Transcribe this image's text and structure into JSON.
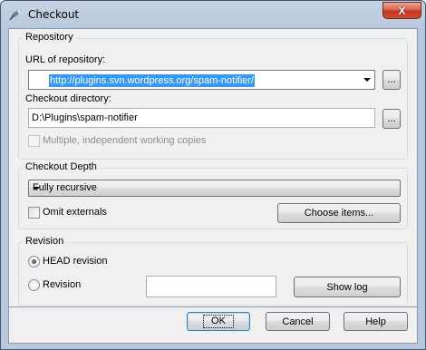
{
  "window": {
    "title": "Checkout",
    "close_label": "X"
  },
  "repository": {
    "group_label": "Repository",
    "url_label": "URL of repository:",
    "url_value": "http://plugins.svn.wordpress.org/spam-notifier/",
    "url_browse_label": "...",
    "dir_label": "Checkout directory:",
    "dir_value": "D:\\Plugins\\spam-notifier",
    "dir_browse_label": "...",
    "multiple_label": "Multiple, independent working copies"
  },
  "depth": {
    "group_label": "Checkout Depth",
    "selected": "Fully recursive",
    "omit_externals_label": "Omit externals",
    "choose_items_label": "Choose items..."
  },
  "revision": {
    "group_label": "Revision",
    "head_label": "HEAD revision",
    "revision_label": "Revision",
    "revision_value": "",
    "show_log_label": "Show log"
  },
  "buttons": {
    "ok": "OK",
    "cancel": "Cancel",
    "help": "Help"
  }
}
